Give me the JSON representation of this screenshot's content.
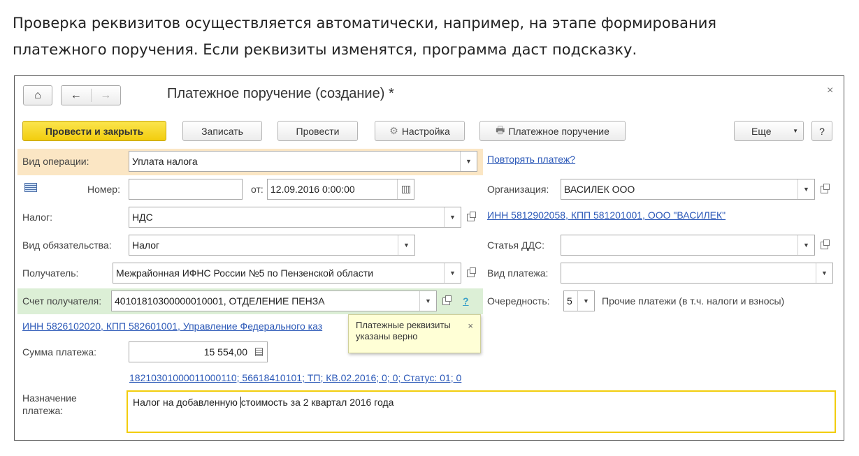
{
  "caption": {
    "line1": "Проверка реквизитов осуществляется автоматически, например, на этапе формирования",
    "line2": "платежного поручения.  Если реквизиты изменятся, программа даст подсказку."
  },
  "window": {
    "title": "Платежное поручение (создание) *",
    "close": "×",
    "nav": {
      "home": "⌂",
      "back": "←",
      "forward": "→"
    }
  },
  "toolbar": {
    "post_close": "Провести и закрыть",
    "save": "Записать",
    "post": "Провести",
    "settings": "Настройка",
    "print": "Платежное поручение",
    "more": "Еще",
    "help": "?"
  },
  "form": {
    "op_type_label": "Вид операции:",
    "op_type_value": "Уплата налога",
    "repeat_link": "Повторять платеж?",
    "number_label": "Номер:",
    "number_value": "",
    "date_label": "от:",
    "date_value": "12.09.2016  0:00:00",
    "org_label": "Организация:",
    "org_value": "ВАСИЛЕК ООО",
    "tax_label": "Налог:",
    "tax_value": "НДС",
    "org_link": "ИНН 5812902058, КПП 581201001, ООО \"ВАСИЛЕК\"",
    "obligation_label": "Вид обязательства:",
    "obligation_value": "Налог",
    "dds_label": "Статья ДДС:",
    "dds_value": "",
    "recipient_label": "Получатель:",
    "recipient_value": "Межрайонная ИФНС России №5 по Пензенской области",
    "payment_type_label": "Вид платежа:",
    "payment_type_value": "",
    "account_label": "Счет получателя:",
    "account_value": "40101810300000010001, ОТДЕЛЕНИЕ ПЕНЗА",
    "account_help": "?",
    "priority_label": "Очередность:",
    "priority_value": "5",
    "priority_text": "Прочие платежи (в т.ч. налоги и взносы)",
    "recipient_link": "ИНН 5826102020, КПП 582601001, Управление Федерального каз",
    "sum_label": "Сумма платежа:",
    "sum_value": "15 554,00",
    "budget_link": "18210301000011000110; 56618410101; ТП; КВ.02.2016; 0; 0; Статус: 01; 0",
    "purpose_label_1": "Назначение",
    "purpose_label_2": "платежа:",
    "purpose_before_cursor": "Налог на добавленную ",
    "purpose_after_cursor": "стоимость за 2 квартал 2016 года"
  },
  "tooltip": {
    "line1": "Платежные реквизиты",
    "line2": "указаны верно",
    "close": "×"
  },
  "icons": {
    "dropdown": "▼"
  }
}
